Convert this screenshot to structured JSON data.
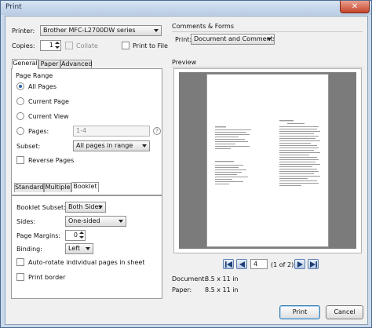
{
  "window": {
    "title": "Print",
    "close_icon": "close-icon"
  },
  "printer": {
    "label": "Printer:",
    "selected": "Brother MFC-L2700DW series",
    "copies_label": "Copies:",
    "copies_value": "1",
    "collate_label": "Collate",
    "print_to_file_label": "Print to File"
  },
  "comments_forms": {
    "header": "Comments & Forms",
    "print_label": "Print:",
    "print_selected": "Document and Comments"
  },
  "main_tabs": [
    {
      "label": "General",
      "active": true
    },
    {
      "label": "Paper",
      "active": false
    },
    {
      "label": "Advanced",
      "active": false
    }
  ],
  "page_range": {
    "header": "Page Range",
    "options": [
      "All Pages",
      "Current Page",
      "Current View",
      "Pages:"
    ],
    "selected": "All Pages",
    "pages_value": "1-4",
    "help_glyph": "?",
    "subset_label": "Subset:",
    "subset_selected": "All pages in range",
    "reverse_label": "Reverse Pages"
  },
  "layout_tabs": [
    {
      "label": "Standard",
      "active": false
    },
    {
      "label": "Multiple",
      "active": false
    },
    {
      "label": "Booklet",
      "active": true
    }
  ],
  "booklet": {
    "subset_label": "Booklet Subset:",
    "subset_selected": "Both Sides",
    "sides_label": "Sides:",
    "sides_selected": "One-sided",
    "margins_label": "Page Margins:",
    "margins_value": "0",
    "binding_label": "Binding:",
    "binding_selected": "Left",
    "autorotate_label": "Auto-rotate individual pages in sheet",
    "print_border_label": "Print border"
  },
  "preview": {
    "header": "Preview",
    "page_input": "4",
    "page_of": "(1 of 2)",
    "document_label": "Document:",
    "document_size": "8.5 x 11 in",
    "paper_label": "Paper:",
    "paper_size": "8.5 x 11 in"
  },
  "buttons": {
    "print": "Print",
    "cancel": "Cancel"
  },
  "colors": {
    "accent": "#2b5fa6",
    "frame": "#c9d8ea"
  }
}
